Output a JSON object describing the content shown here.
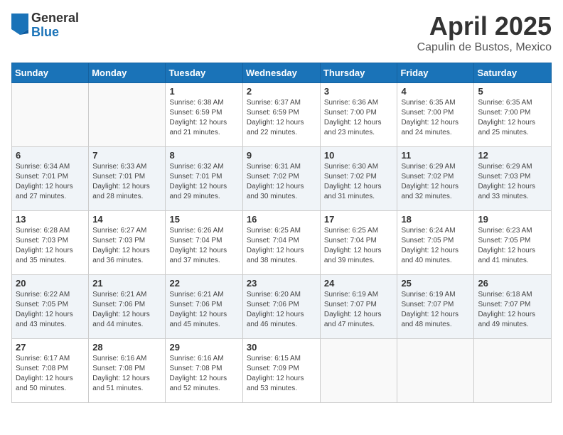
{
  "header": {
    "logo_general": "General",
    "logo_blue": "Blue",
    "month_title": "April 2025",
    "location": "Capulin de Bustos, Mexico"
  },
  "calendar": {
    "headers": [
      "Sunday",
      "Monday",
      "Tuesday",
      "Wednesday",
      "Thursday",
      "Friday",
      "Saturday"
    ],
    "weeks": [
      [
        {
          "day": "",
          "info": ""
        },
        {
          "day": "",
          "info": ""
        },
        {
          "day": "1",
          "info": "Sunrise: 6:38 AM\nSunset: 6:59 PM\nDaylight: 12 hours\nand 21 minutes."
        },
        {
          "day": "2",
          "info": "Sunrise: 6:37 AM\nSunset: 6:59 PM\nDaylight: 12 hours\nand 22 minutes."
        },
        {
          "day": "3",
          "info": "Sunrise: 6:36 AM\nSunset: 7:00 PM\nDaylight: 12 hours\nand 23 minutes."
        },
        {
          "day": "4",
          "info": "Sunrise: 6:35 AM\nSunset: 7:00 PM\nDaylight: 12 hours\nand 24 minutes."
        },
        {
          "day": "5",
          "info": "Sunrise: 6:35 AM\nSunset: 7:00 PM\nDaylight: 12 hours\nand 25 minutes."
        }
      ],
      [
        {
          "day": "6",
          "info": "Sunrise: 6:34 AM\nSunset: 7:01 PM\nDaylight: 12 hours\nand 27 minutes."
        },
        {
          "day": "7",
          "info": "Sunrise: 6:33 AM\nSunset: 7:01 PM\nDaylight: 12 hours\nand 28 minutes."
        },
        {
          "day": "8",
          "info": "Sunrise: 6:32 AM\nSunset: 7:01 PM\nDaylight: 12 hours\nand 29 minutes."
        },
        {
          "day": "9",
          "info": "Sunrise: 6:31 AM\nSunset: 7:02 PM\nDaylight: 12 hours\nand 30 minutes."
        },
        {
          "day": "10",
          "info": "Sunrise: 6:30 AM\nSunset: 7:02 PM\nDaylight: 12 hours\nand 31 minutes."
        },
        {
          "day": "11",
          "info": "Sunrise: 6:29 AM\nSunset: 7:02 PM\nDaylight: 12 hours\nand 32 minutes."
        },
        {
          "day": "12",
          "info": "Sunrise: 6:29 AM\nSunset: 7:03 PM\nDaylight: 12 hours\nand 33 minutes."
        }
      ],
      [
        {
          "day": "13",
          "info": "Sunrise: 6:28 AM\nSunset: 7:03 PM\nDaylight: 12 hours\nand 35 minutes."
        },
        {
          "day": "14",
          "info": "Sunrise: 6:27 AM\nSunset: 7:03 PM\nDaylight: 12 hours\nand 36 minutes."
        },
        {
          "day": "15",
          "info": "Sunrise: 6:26 AM\nSunset: 7:04 PM\nDaylight: 12 hours\nand 37 minutes."
        },
        {
          "day": "16",
          "info": "Sunrise: 6:25 AM\nSunset: 7:04 PM\nDaylight: 12 hours\nand 38 minutes."
        },
        {
          "day": "17",
          "info": "Sunrise: 6:25 AM\nSunset: 7:04 PM\nDaylight: 12 hours\nand 39 minutes."
        },
        {
          "day": "18",
          "info": "Sunrise: 6:24 AM\nSunset: 7:05 PM\nDaylight: 12 hours\nand 40 minutes."
        },
        {
          "day": "19",
          "info": "Sunrise: 6:23 AM\nSunset: 7:05 PM\nDaylight: 12 hours\nand 41 minutes."
        }
      ],
      [
        {
          "day": "20",
          "info": "Sunrise: 6:22 AM\nSunset: 7:05 PM\nDaylight: 12 hours\nand 43 minutes."
        },
        {
          "day": "21",
          "info": "Sunrise: 6:21 AM\nSunset: 7:06 PM\nDaylight: 12 hours\nand 44 minutes."
        },
        {
          "day": "22",
          "info": "Sunrise: 6:21 AM\nSunset: 7:06 PM\nDaylight: 12 hours\nand 45 minutes."
        },
        {
          "day": "23",
          "info": "Sunrise: 6:20 AM\nSunset: 7:06 PM\nDaylight: 12 hours\nand 46 minutes."
        },
        {
          "day": "24",
          "info": "Sunrise: 6:19 AM\nSunset: 7:07 PM\nDaylight: 12 hours\nand 47 minutes."
        },
        {
          "day": "25",
          "info": "Sunrise: 6:19 AM\nSunset: 7:07 PM\nDaylight: 12 hours\nand 48 minutes."
        },
        {
          "day": "26",
          "info": "Sunrise: 6:18 AM\nSunset: 7:07 PM\nDaylight: 12 hours\nand 49 minutes."
        }
      ],
      [
        {
          "day": "27",
          "info": "Sunrise: 6:17 AM\nSunset: 7:08 PM\nDaylight: 12 hours\nand 50 minutes."
        },
        {
          "day": "28",
          "info": "Sunrise: 6:16 AM\nSunset: 7:08 PM\nDaylight: 12 hours\nand 51 minutes."
        },
        {
          "day": "29",
          "info": "Sunrise: 6:16 AM\nSunset: 7:08 PM\nDaylight: 12 hours\nand 52 minutes."
        },
        {
          "day": "30",
          "info": "Sunrise: 6:15 AM\nSunset: 7:09 PM\nDaylight: 12 hours\nand 53 minutes."
        },
        {
          "day": "",
          "info": ""
        },
        {
          "day": "",
          "info": ""
        },
        {
          "day": "",
          "info": ""
        }
      ]
    ]
  }
}
